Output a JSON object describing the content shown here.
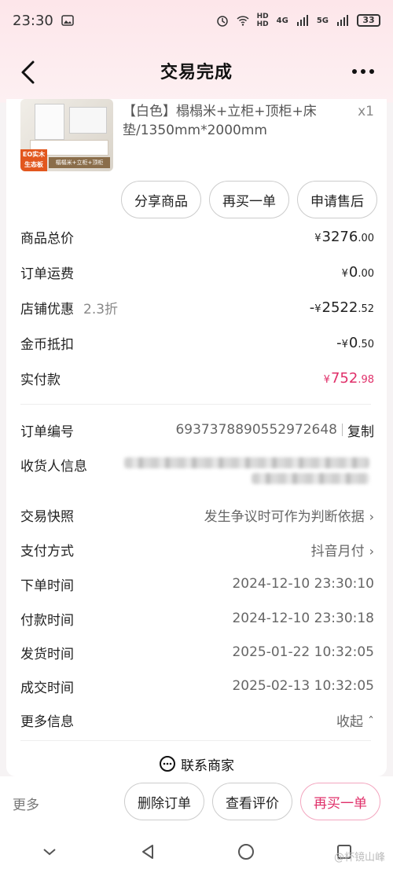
{
  "status": {
    "time": "23:30",
    "battery": "33",
    "hd1": "HD",
    "hd2": "HD",
    "net1": "4G",
    "net2": "5G"
  },
  "header": {
    "title": "交易完成"
  },
  "product": {
    "name": "【白色】榻榻米+立柜+顶柜+床垫/1350mm*2000mm",
    "qty": "x1",
    "thumb_tag": "EO实木 生态板",
    "thumb_strip": "榻榻米+立柜+顶柜"
  },
  "actions": {
    "share": "分享商品",
    "rebuy": "再买一单",
    "aftersale": "申请售后"
  },
  "amounts": [
    {
      "label": "商品总价",
      "sub": "",
      "cur": "¥",
      "int": "3276",
      "dec": ".00",
      "pink": false,
      "prefix": ""
    },
    {
      "label": "订单运费",
      "sub": "",
      "cur": "¥",
      "int": "0",
      "dec": ".00",
      "pink": false,
      "prefix": ""
    },
    {
      "label": "店铺优惠",
      "sub": "2.3折",
      "cur": "¥",
      "int": "2522",
      "dec": ".52",
      "pink": false,
      "prefix": "-"
    },
    {
      "label": "金币抵扣",
      "sub": "",
      "cur": "¥",
      "int": "0",
      "dec": ".50",
      "pink": false,
      "prefix": "-"
    },
    {
      "label": "实付款",
      "sub": "",
      "cur": "¥",
      "int": "752",
      "dec": ".98",
      "pink": true,
      "prefix": ""
    }
  ],
  "order": {
    "number_label": "订单编号",
    "number": "6937378890552972648",
    "copy": "复制",
    "receiver_label": "收货人信息",
    "snapshot_label": "交易快照",
    "snapshot_value": "发生争议时可作为判断依据",
    "payment_label": "支付方式",
    "payment_value": "抖音月付",
    "times": [
      {
        "label": "下单时间",
        "value": "2024-12-10 23:30:10"
      },
      {
        "label": "付款时间",
        "value": "2024-12-10 23:30:18"
      },
      {
        "label": "发货时间",
        "value": "2025-01-22 10:32:05"
      },
      {
        "label": "成交时间",
        "value": "2025-02-13 10:32:05"
      }
    ],
    "more_label": "更多信息",
    "more_value": "收起"
  },
  "contact": "联系商家",
  "bottom": {
    "more": "更多",
    "delete": "删除订单",
    "review": "查看评价",
    "rebuy": "再买一单"
  },
  "watermark": "@杯镜山峰",
  "colors": {
    "accent": "#e0306a",
    "bg": "#fde6ea"
  }
}
